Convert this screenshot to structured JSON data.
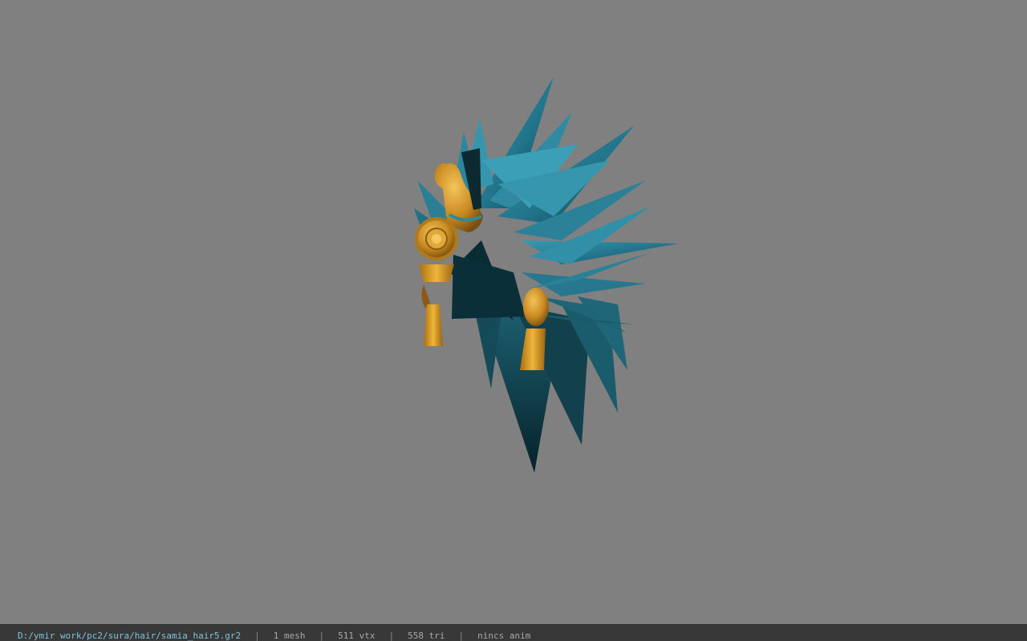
{
  "viewport": {
    "background_color": "#808080",
    "model": {
      "subject": "hair-mesh",
      "hair_color": "#2a7f95",
      "ornament_color": "#d89a2a"
    }
  },
  "statusbar": {
    "file_path": "D:/ymir work/pc2/sura/hair/samia_hair5.gr2",
    "sep": "|",
    "mesh": "1 mesh",
    "vertices": "511 vtx",
    "triangles": "558 tri",
    "anim": "nincs anim"
  }
}
